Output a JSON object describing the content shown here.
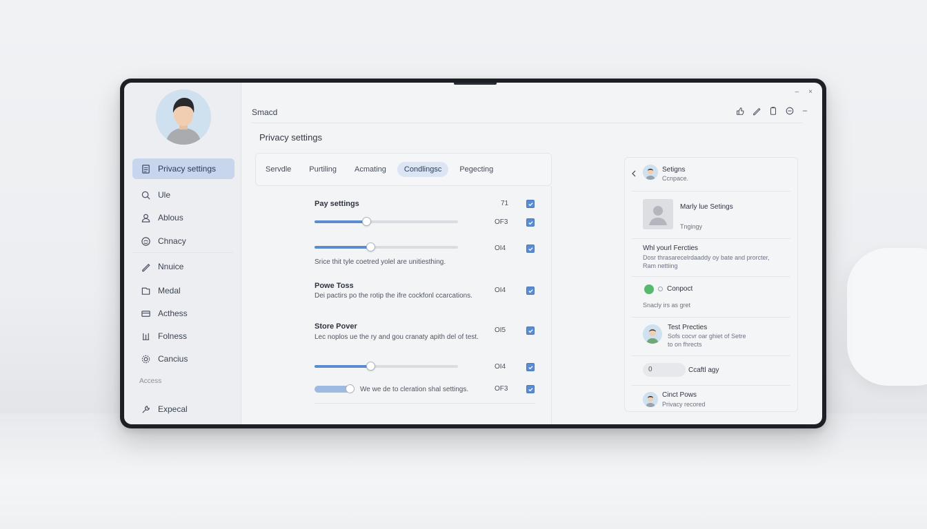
{
  "window": {
    "title": "Smacd",
    "minimize": "–",
    "maximize": "×"
  },
  "sidebar": {
    "items": [
      {
        "label": "Privacy settings",
        "icon": "document-icon"
      },
      {
        "label": "Ule",
        "icon": "search-icon"
      },
      {
        "label": "Ablous",
        "icon": "user-icon"
      },
      {
        "label": "Chnacy",
        "icon": "shield-icon"
      },
      {
        "label": "Nnuice",
        "icon": "pen-icon"
      },
      {
        "label": "Medal",
        "icon": "folder-icon"
      },
      {
        "label": "Acthess",
        "icon": "card-icon"
      },
      {
        "label": "Folness",
        "icon": "bars-icon"
      },
      {
        "label": "Cancius",
        "icon": "gear-icon"
      }
    ],
    "section_label": "Access",
    "footer_item": {
      "label": "Expecal",
      "icon": "tools-icon"
    }
  },
  "main": {
    "page_title": "Privacy settings",
    "tabs": [
      {
        "label": "Servdle"
      },
      {
        "label": "Purtiling"
      },
      {
        "label": "Acmating"
      },
      {
        "label": "Condlingsc",
        "active": true
      },
      {
        "label": "Pegecting"
      }
    ],
    "settings": {
      "pay_title": "Pay settings",
      "pay_value": "71",
      "slider1_value": "OF3",
      "slider1_level": 0.36,
      "slider2_value": "OI4",
      "slider2_level": 0.39,
      "slider_desc": "Srice thit tyle coetred yolel are unitiesthing.",
      "powe_title": "Powe Toss",
      "powe_desc": "Dei pactirs po the rotip the ifre cockfonl ccarcations.",
      "powe_value": "OI4",
      "store_title": "Store Pover",
      "store_desc": "Lec noplos ue the ry and gou cranaty apith del of test.",
      "store_value": "OI5",
      "slider3_value": "OI4",
      "slider3_level": 0.39,
      "toggle_desc": "We we de to cleration shal settings.",
      "toggle_value": "OF3"
    }
  },
  "right_panel": {
    "header_title": "Setigns",
    "header_sub": "Ccnpace.",
    "profile_title": "Marly lue Setings",
    "profile_sub": "Tngingy",
    "section_title": "Whl yourl Fercties",
    "section_desc": "Dosr thrasarecelrdaaddy oy bate and prorcter, Ram nettiing",
    "status_label": "Conpoct",
    "status_desc": "Snacly irs as gret",
    "test_title": "Test Precties",
    "test_desc": "Sofs cocvr oar ghiet of Setre to on fhrects",
    "input_value": "0",
    "input_label": "Ccaftl agy",
    "footer_title": "Cinct Pows",
    "footer_sub": "Privacy recored",
    "accent_green": "#57b96b"
  },
  "colors": {
    "accent": "#5b8bd0",
    "active_nav": "#c7d6ec"
  }
}
